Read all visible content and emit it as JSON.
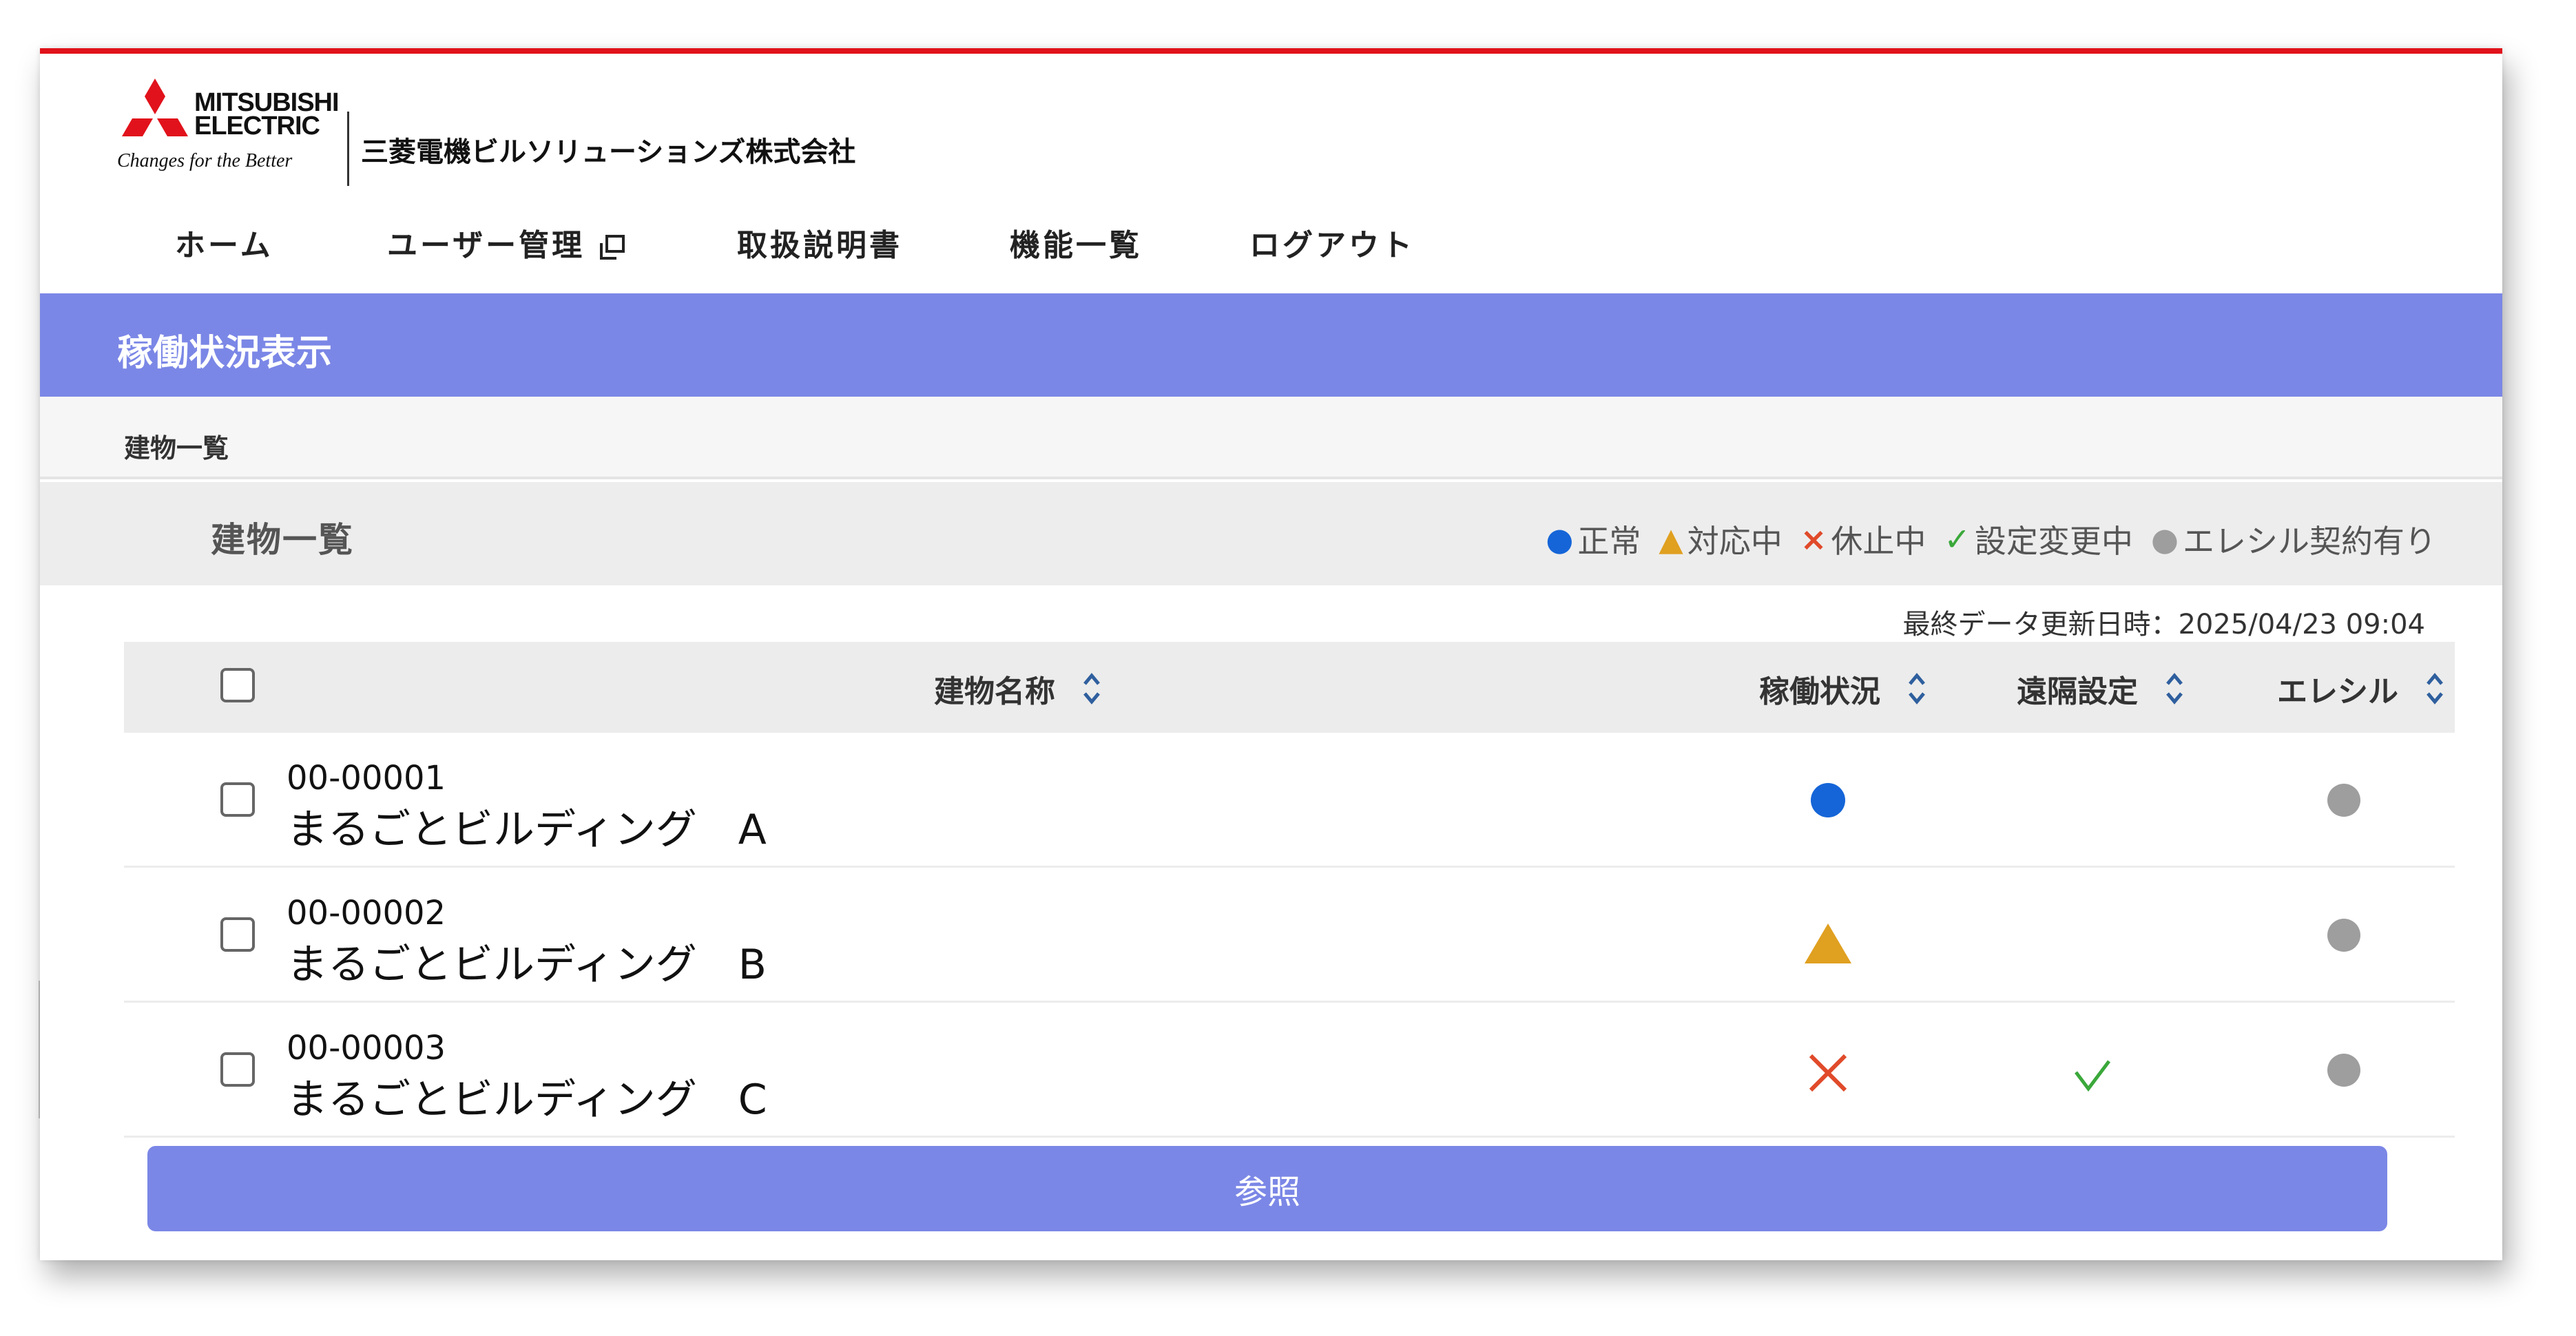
{
  "brand": {
    "logo_line1": "MITSUBISHI",
    "logo_line2": "ELECTRIC",
    "tagline": "Changes for the Better",
    "company": "三菱電機ビルソリューションズ株式会社",
    "logo_icon": "three-diamonds-logo",
    "accent_color": "#e1121b"
  },
  "nav": {
    "items": [
      {
        "label": "ホーム"
      },
      {
        "label": "ユーザー管理",
        "icon": "external-window-icon"
      },
      {
        "label": "取扱説明書"
      },
      {
        "label": "機能一覧"
      },
      {
        "label": "ログアウト"
      }
    ]
  },
  "page": {
    "title": "稼働状況表示",
    "breadcrumb": "建物一覧",
    "section_title": "建物一覧",
    "header_color": "#7b87e6"
  },
  "legend": {
    "normal": {
      "symbol": "●",
      "label": "正常",
      "color": "#1565d8"
    },
    "responding": {
      "symbol": "▲",
      "label": "対応中",
      "color": "#e0a020"
    },
    "stopped": {
      "symbol": "×",
      "label": "休止中",
      "color": "#e04a2a"
    },
    "changing": {
      "symbol": "✓",
      "label": "設定変更中",
      "color": "#3aa83a"
    },
    "ereshiru": {
      "symbol": "●",
      "label": "エレシル契約有り",
      "color": "#9e9e9e"
    }
  },
  "last_updated": "最終データ更新日時：2025/04/23 09:04",
  "table": {
    "columns": {
      "name": "建物名称",
      "status": "稼働状況",
      "remote": "遠隔設定",
      "ereshiru": "エレシル"
    },
    "rows": [
      {
        "code": "00-00001",
        "name": "まるごとビルディング　A",
        "status": "normal",
        "remote": "",
        "ereshiru": "contracted"
      },
      {
        "code": "00-00002",
        "name": "まるごとビルディング　B",
        "status": "responding",
        "remote": "",
        "ereshiru": "contracted"
      },
      {
        "code": "00-00003",
        "name": "まるごとビルディング　C",
        "status": "stopped",
        "remote": "changing",
        "ereshiru": "contracted"
      }
    ]
  },
  "actions": {
    "reference_label": "参照"
  }
}
